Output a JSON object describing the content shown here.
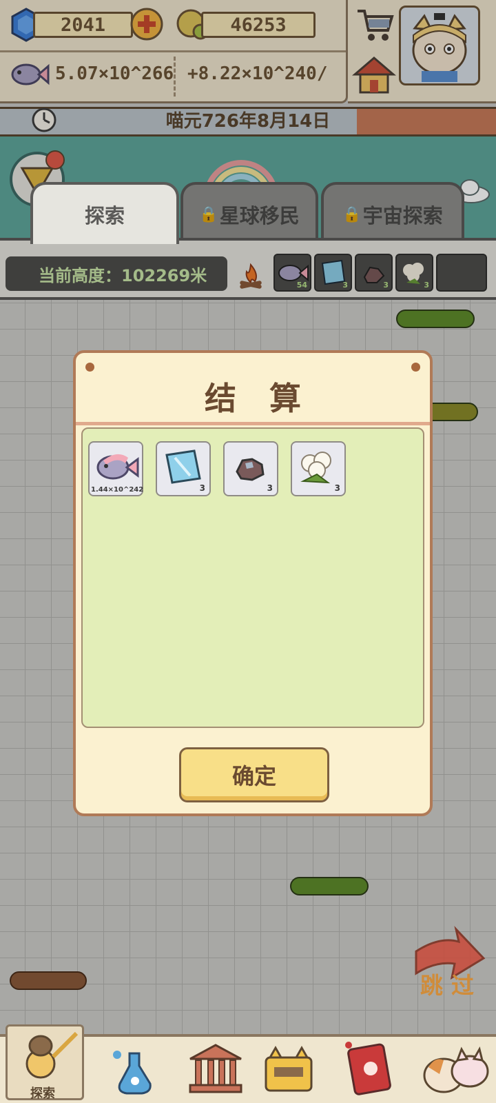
{
  "resources": {
    "gems": "2041",
    "coins": "46253",
    "fish_total": "5.07×10^266",
    "fish_rate": "+8.22×10^240/"
  },
  "date": "喵元726年8月14日",
  "tabs": [
    {
      "label": "探索",
      "locked": false
    },
    {
      "label": "星球移民",
      "locked": true
    },
    {
      "label": "宇宙探索",
      "locked": true
    }
  ],
  "current_height": "当前高度：102269米",
  "inventory": [
    {
      "item": "fish",
      "count": "54"
    },
    {
      "item": "glass",
      "count": "3"
    },
    {
      "item": "ore",
      "count": "3"
    },
    {
      "item": "cotton",
      "count": "3"
    },
    {
      "item": "empty",
      "count": ""
    }
  ],
  "dialog": {
    "title": "结算",
    "rewards": [
      {
        "item": "fish",
        "count": "1.44×10^242"
      },
      {
        "item": "glass",
        "count": "3"
      },
      {
        "item": "ore",
        "count": "3"
      },
      {
        "item": "cotton",
        "count": "3"
      }
    ],
    "confirm_label": "确定"
  },
  "skip_label": "跳过",
  "bottom_nav": {
    "explore_label": "探索"
  },
  "colors": {
    "accent_teal": "#5fa79c",
    "dialog_bg": "#fbf1d0",
    "reward_bg": "#e3eeb8",
    "button_yellow": "#f8df88"
  }
}
